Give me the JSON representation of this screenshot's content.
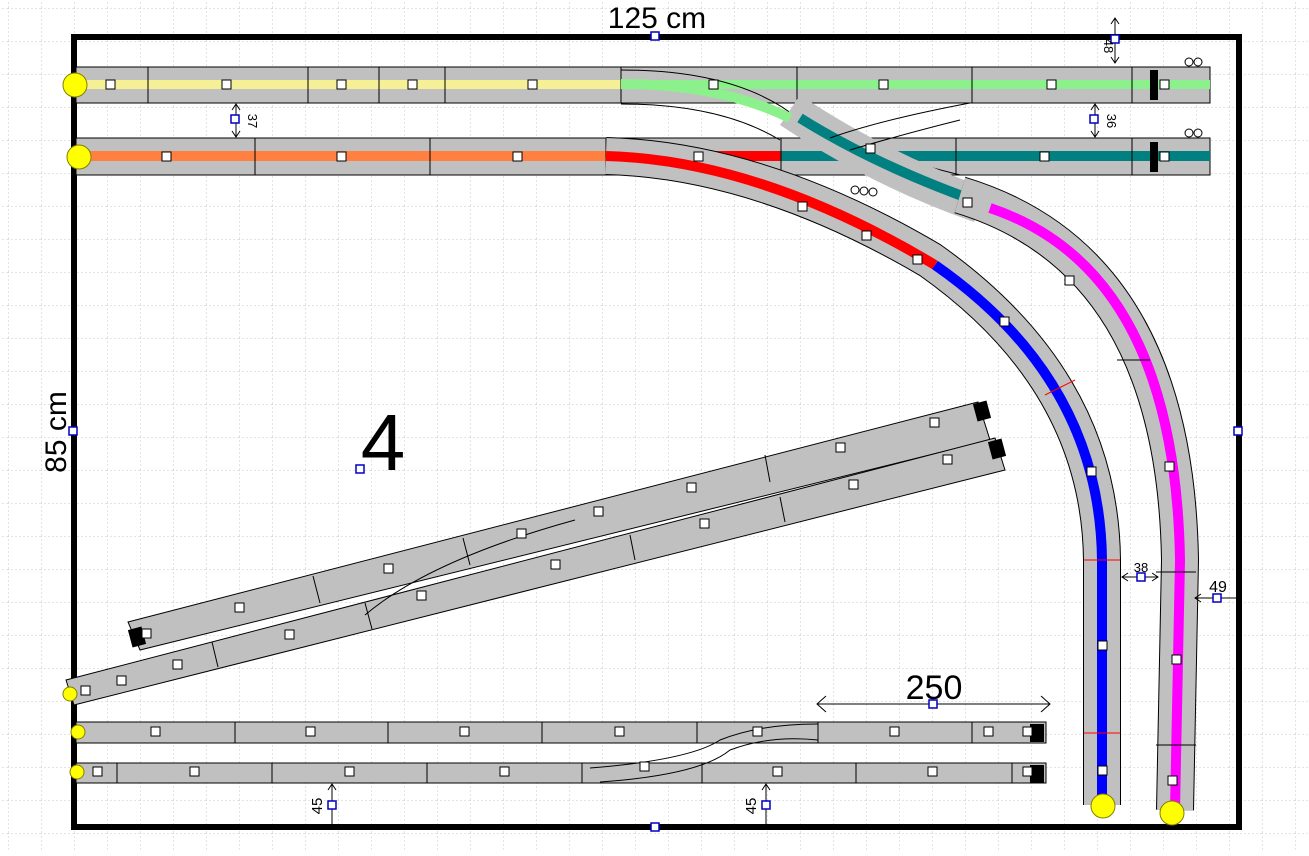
{
  "board": {
    "width_label": "125 cm",
    "height_label": "85 cm",
    "layout_number": "4"
  },
  "dimensions": {
    "d_48": "48",
    "d_37": "37",
    "d_36": "36",
    "d_38": "38",
    "d_49": "49",
    "d_250": "250",
    "d_45_left": "45",
    "d_45_right": "45"
  },
  "colors": {
    "yellow_route": "#f5f096",
    "green_route": "#8cf08c",
    "orange_route": "#ff8040",
    "red_route": "#ff0000",
    "teal_route": "#008080",
    "blue_route": "#0000ff",
    "magenta_route": "#ff00ff",
    "track_gray": "#c0c0c0",
    "end_marker": "#ffff00"
  }
}
